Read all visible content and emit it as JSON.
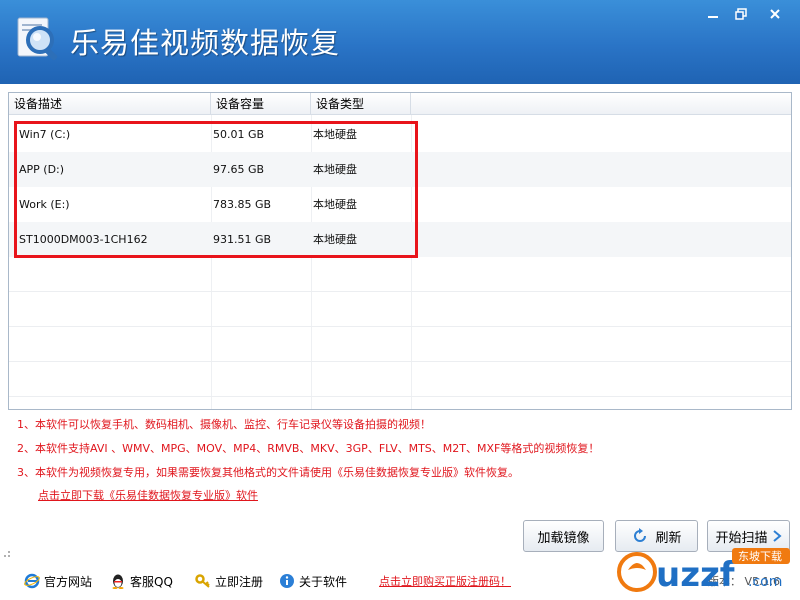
{
  "app": {
    "title": "乐易佳视频数据恢复"
  },
  "window_controls": {
    "minimize": "▁",
    "maximize": "▫",
    "close": "✕"
  },
  "table": {
    "headers": [
      "设备描述",
      "设备容量",
      "设备类型"
    ],
    "rows": [
      {
        "name": "Win7 (C:)",
        "capacity": "50.01 GB",
        "type": "本地硬盘"
      },
      {
        "name": "APP (D:)",
        "capacity": "97.65 GB",
        "type": "本地硬盘"
      },
      {
        "name": "Work (E:)",
        "capacity": "783.85 GB",
        "type": "本地硬盘"
      },
      {
        "name": "ST1000DM003-1CH162",
        "capacity": "931.51 GB",
        "type": "本地硬盘"
      }
    ]
  },
  "notes": [
    "1、本软件可以恢复手机、数码相机、摄像机、监控、行车记录仪等设备拍摄的视频！",
    "2、本软件支持AVI 、WMV、MPG、MOV、MP4、RMVB、MKV、3GP、FLV、MTS、M2T、MXF等格式的视频恢复！",
    "3、本软件为视频恢复专用，如果需要恢复其他格式的文件请使用《乐易佳数据恢复专业版》软件恢复。"
  ],
  "download_link": "点击立即下载《乐易佳数据恢复专业版》软件",
  "buttons": {
    "load_image": "加载镜像",
    "refresh": "刷新",
    "start_scan": "开始扫描"
  },
  "footer": {
    "website": "官方网站",
    "qq": "客服QQ",
    "register": "立即注册",
    "about": "关于软件",
    "buy_link": "点击立即购买正版注册码！",
    "version": "版本： V5.1.6"
  },
  "watermark": {
    "text": "uzzf.com",
    "badge": "东坡下载"
  },
  "colors": {
    "title_bar": "#2a74c6",
    "highlight": "#e8141b",
    "note_text": "#e0161d"
  }
}
